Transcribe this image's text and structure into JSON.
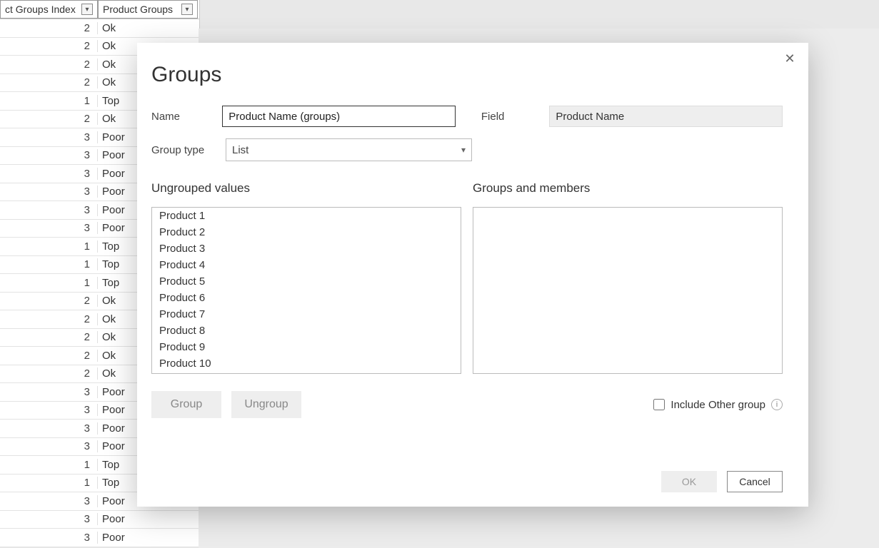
{
  "sheet": {
    "headers": [
      "ct Groups Index",
      "Product Groups"
    ],
    "rows": [
      {
        "idx": "2",
        "grp": "Ok"
      },
      {
        "idx": "2",
        "grp": "Ok"
      },
      {
        "idx": "2",
        "grp": "Ok"
      },
      {
        "idx": "2",
        "grp": "Ok"
      },
      {
        "idx": "1",
        "grp": "Top"
      },
      {
        "idx": "2",
        "grp": "Ok"
      },
      {
        "idx": "3",
        "grp": "Poor"
      },
      {
        "idx": "3",
        "grp": "Poor"
      },
      {
        "idx": "3",
        "grp": "Poor"
      },
      {
        "idx": "3",
        "grp": "Poor"
      },
      {
        "idx": "3",
        "grp": "Poor"
      },
      {
        "idx": "3",
        "grp": "Poor"
      },
      {
        "idx": "1",
        "grp": "Top"
      },
      {
        "idx": "1",
        "grp": "Top"
      },
      {
        "idx": "1",
        "grp": "Top"
      },
      {
        "idx": "2",
        "grp": "Ok"
      },
      {
        "idx": "2",
        "grp": "Ok"
      },
      {
        "idx": "2",
        "grp": "Ok"
      },
      {
        "idx": "2",
        "grp": "Ok"
      },
      {
        "idx": "2",
        "grp": "Ok"
      },
      {
        "idx": "3",
        "grp": "Poor"
      },
      {
        "idx": "3",
        "grp": "Poor"
      },
      {
        "idx": "3",
        "grp": "Poor"
      },
      {
        "idx": "3",
        "grp": "Poor"
      },
      {
        "idx": "1",
        "grp": "Top"
      },
      {
        "idx": "1",
        "grp": "Top"
      },
      {
        "idx": "3",
        "grp": "Poor"
      },
      {
        "idx": "3",
        "grp": "Poor"
      },
      {
        "idx": "3",
        "grp": "Poor"
      }
    ]
  },
  "dialog": {
    "title": "Groups",
    "name_label": "Name",
    "name_value": "Product Name (groups)",
    "field_label": "Field",
    "field_value": "Product Name",
    "grouptype_label": "Group type",
    "grouptype_value": "List",
    "ungrouped_title": "Ungrouped values",
    "groups_title": "Groups and members",
    "ungrouped_items": [
      "Product 1",
      "Product 2",
      "Product 3",
      "Product 4",
      "Product 5",
      "Product 6",
      "Product 7",
      "Product 8",
      "Product 9",
      "Product 10"
    ],
    "group_btn": "Group",
    "ungroup_btn": "Ungroup",
    "include_label": "Include Other group",
    "ok": "OK",
    "cancel": "Cancel"
  }
}
